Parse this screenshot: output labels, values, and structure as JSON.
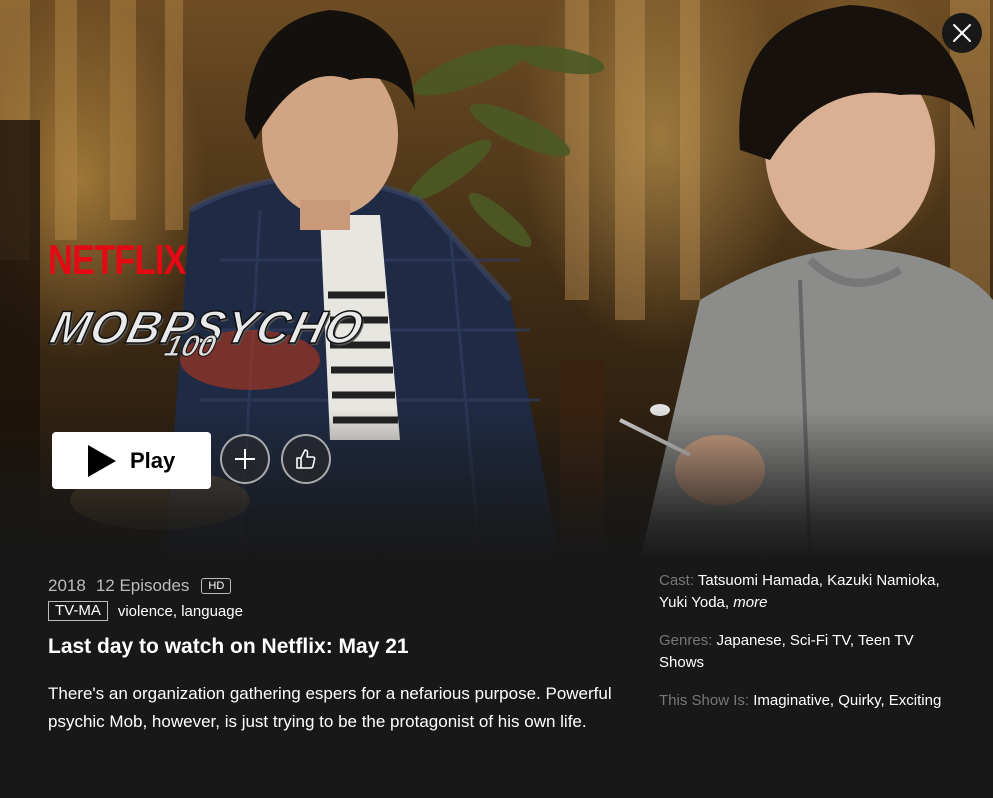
{
  "hero": {
    "brand": "NETFLIX",
    "show_logo_main": "MOBPSYCHO",
    "show_logo_num": "100"
  },
  "actions": {
    "play_label": "Play",
    "add_icon": "plus-icon",
    "rate_icon": "thumbs-up-icon",
    "close_icon": "close-icon"
  },
  "details": {
    "year": "2018",
    "episodes": "12 Episodes",
    "quality_badge": "HD",
    "maturity_rating": "TV-MA",
    "advisories": "violence, language",
    "availability": "Last day to watch on Netflix: May 21",
    "synopsis": "There's an organization gathering espers for a nefarious purpose. Powerful psychic Mob, however, is just trying to be the protagonist of his own life."
  },
  "sidebar": {
    "cast_label": "Cast:",
    "cast": "Tatsuomi Hamada, Kazuki Namioka, Yuki Yoda,",
    "cast_more": "more",
    "genres_label": "Genres:",
    "genres": "Japanese, Sci-Fi TV, Teen TV Shows",
    "traits_label": "This Show Is:",
    "traits": "Imaginative, Quirky, Exciting"
  },
  "colors": {
    "brand_red": "#e50914",
    "background": "#181818",
    "muted_text": "#777777",
    "meta_text": "#bcbcbc"
  }
}
